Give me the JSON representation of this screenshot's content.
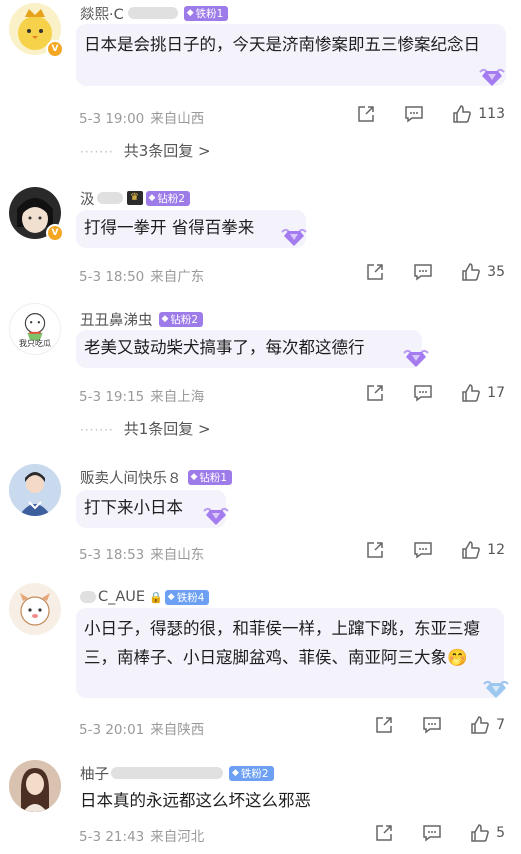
{
  "comments": [
    {
      "username": "燚熙·C",
      "badge": "铁粉1",
      "text": "日本是会挑日子的，今天是济南惨案即五三惨案纪念日",
      "date": "5-3 19:00",
      "location": "来自山西",
      "likes": "113",
      "replies": "共3条回复 >"
    },
    {
      "username": "汲",
      "badge": "钻粉2",
      "text": "打得一拳开 省得百拳来",
      "date": "5-3 18:50",
      "location": "来自广东",
      "likes": "35"
    },
    {
      "username": "丑丑鼻涕虫",
      "badge": "钻粉2",
      "avatar_caption": "我只吃瓜",
      "text": "老美又鼓动柴犬搞事了，每次都这德行",
      "date": "5-3 19:15",
      "location": "来自上海",
      "likes": "17",
      "replies": "共1条回复 >"
    },
    {
      "username": "贩卖人间快乐８",
      "badge": "钻粉1",
      "text": "打下来小日本",
      "date": "5-3 18:53",
      "location": "来自山东",
      "likes": "12"
    },
    {
      "username": "C_AUE",
      "badge": "铁粉4",
      "text": "小日子，得瑟的很，和菲侯一样，上蹿下跳，东亚三瘪三，南棒子、小日寇脚盆鸡、菲侯、南亚阿三大象🤭",
      "date": "5-3 20:01",
      "location": "来自陕西",
      "likes": "7"
    },
    {
      "username": "柚子",
      "badge": "铁粉2",
      "text": "日本真的永远都这么坏这么邪恶",
      "date": "5-3 21:43",
      "location": "来自河北",
      "likes": "5"
    }
  ]
}
